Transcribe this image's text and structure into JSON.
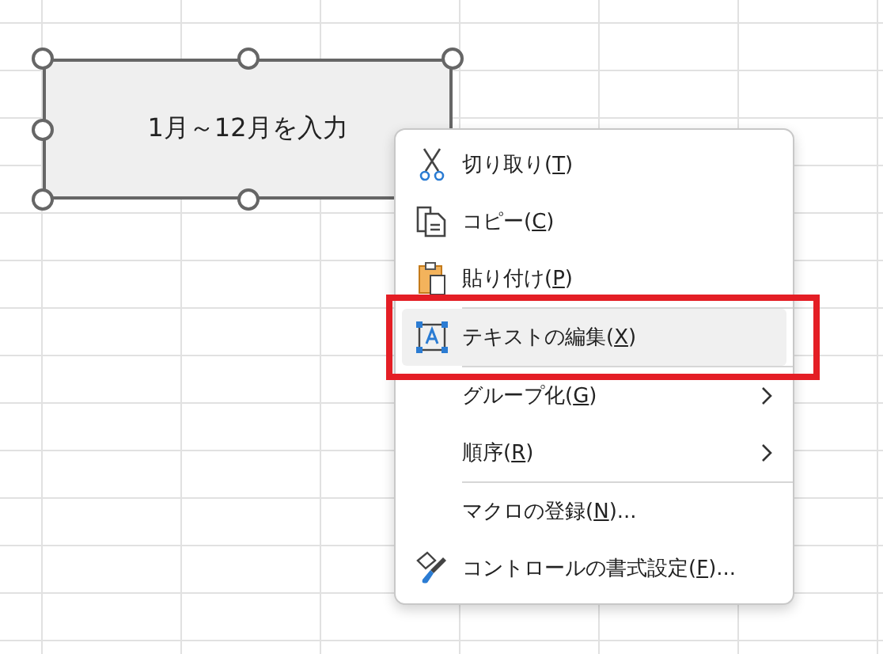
{
  "shape": {
    "text": "1月～12月を入力",
    "selected": true
  },
  "context_menu": {
    "items": [
      {
        "label": "切り取り(",
        "access_key": "T",
        "suffix": ")",
        "selected": false,
        "separator_before": false,
        "submenu": false
      },
      {
        "label": "コピー(",
        "access_key": "C",
        "suffix": ")",
        "selected": false,
        "separator_before": false,
        "submenu": false
      },
      {
        "label": "貼り付け(",
        "access_key": "P",
        "suffix": ")",
        "selected": false,
        "separator_before": false,
        "submenu": false
      },
      {
        "label": "テキストの編集(",
        "access_key": "X",
        "suffix": ")",
        "selected": true,
        "separator_before": true,
        "submenu": false,
        "annotated": true
      },
      {
        "label": "グループ化(",
        "access_key": "G",
        "suffix": ")",
        "selected": false,
        "separator_before": true,
        "submenu": true
      },
      {
        "label": "順序(",
        "access_key": "R",
        "suffix": ")",
        "selected": false,
        "separator_before": false,
        "submenu": true
      },
      {
        "label": "マクロの登録(",
        "access_key": "N",
        "suffix": ")...",
        "selected": false,
        "separator_before": true,
        "submenu": false
      },
      {
        "label": "コントロールの書式設定(",
        "access_key": "F",
        "suffix": ")...",
        "selected": false,
        "separator_before": false,
        "submenu": false
      }
    ]
  }
}
